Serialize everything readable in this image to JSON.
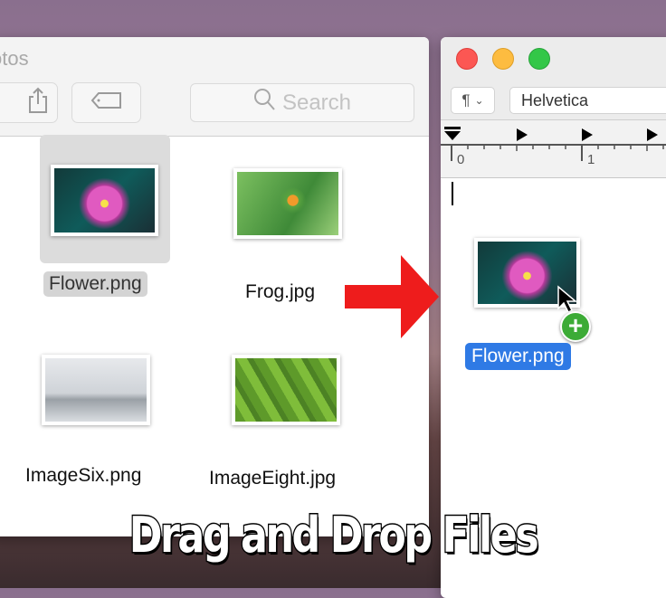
{
  "finder": {
    "title": "otos",
    "search_placeholder": "Search",
    "files": [
      {
        "name": "Flower.png",
        "selected": true
      },
      {
        "name": "Frog.jpg"
      },
      {
        "name": "ImageSix.png"
      },
      {
        "name": "ImageEight.jpg"
      }
    ]
  },
  "textedit": {
    "paragraph_button": "¶",
    "font": "Helvetica",
    "ruler_labels": [
      "0",
      "1"
    ],
    "dropped_file": "Flower.png",
    "copy_badge": "+"
  },
  "caption": "Drag and Drop Files",
  "colors": {
    "arrow": "#ee1c1c",
    "selection": "#2f7ae5",
    "badge": "#3cab36"
  }
}
